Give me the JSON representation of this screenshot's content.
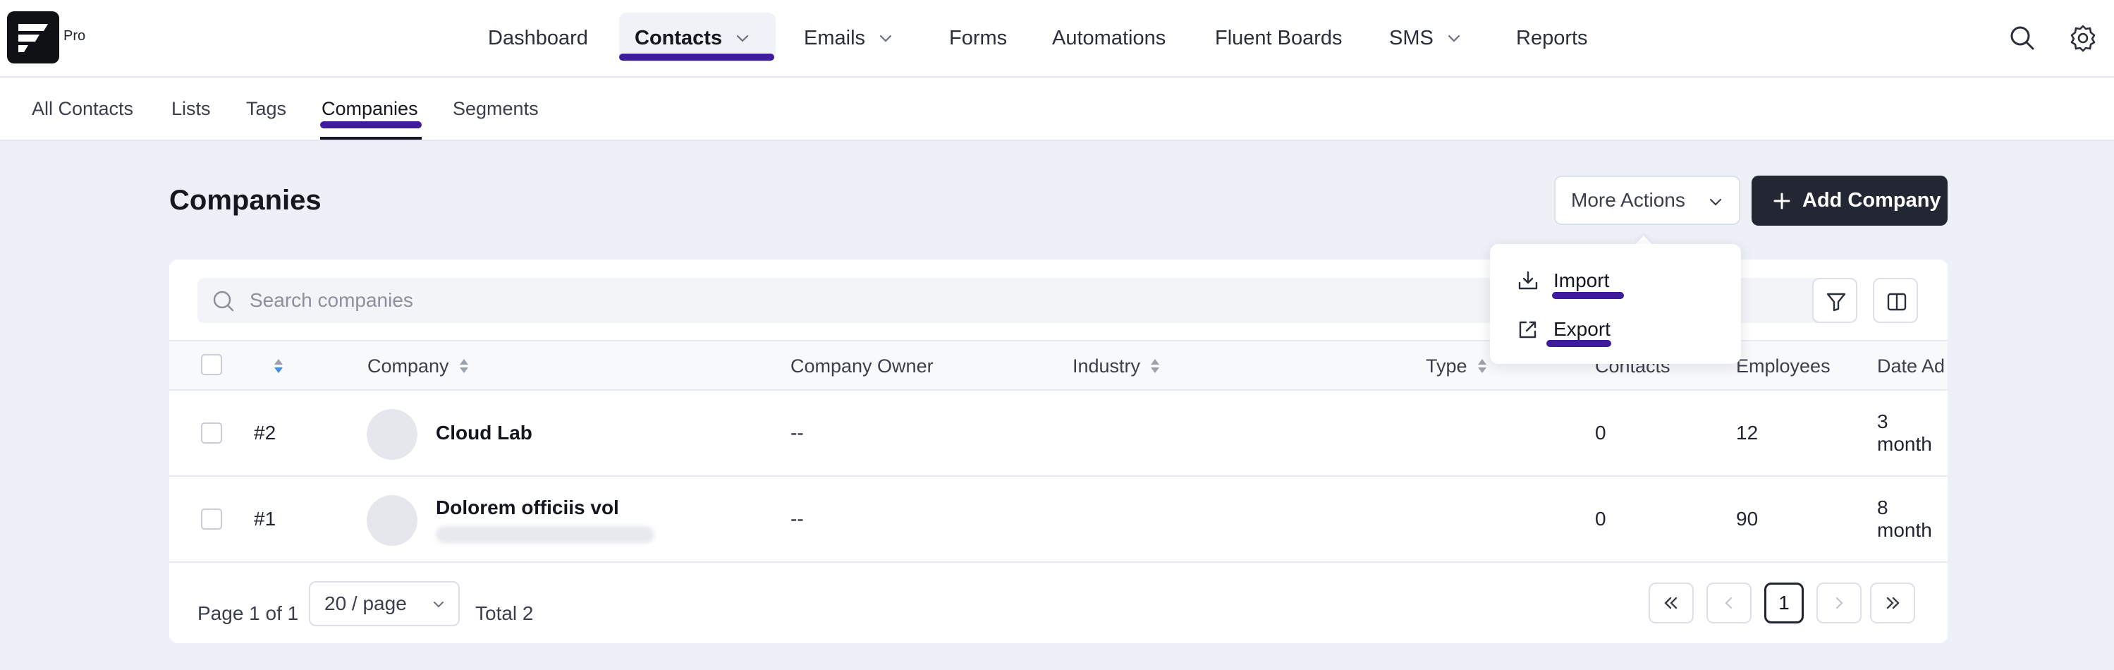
{
  "brand": {
    "badge": "Pro"
  },
  "nav": {
    "items": [
      {
        "label": "Dashboard"
      },
      {
        "label": "Contacts"
      },
      {
        "label": "Emails"
      },
      {
        "label": "Forms"
      },
      {
        "label": "Automations"
      },
      {
        "label": "Fluent Boards"
      },
      {
        "label": "SMS"
      },
      {
        "label": "Reports"
      }
    ],
    "active": "Contacts"
  },
  "subnav": {
    "items": [
      {
        "label": "All Contacts"
      },
      {
        "label": "Lists"
      },
      {
        "label": "Tags"
      },
      {
        "label": "Companies"
      },
      {
        "label": "Segments"
      }
    ],
    "active": "Companies"
  },
  "page": {
    "title": "Companies",
    "more_actions_label": "More Actions",
    "add_label": "Add Company"
  },
  "more_actions_menu": {
    "items": [
      {
        "label": "Import",
        "icon": "import-icon"
      },
      {
        "label": "Export",
        "icon": "export-icon"
      }
    ]
  },
  "search": {
    "placeholder": "Search companies",
    "value": ""
  },
  "table": {
    "columns": [
      "Company",
      "Company Owner",
      "Industry",
      "Type",
      "Contacts",
      "Employees",
      "Date Ad"
    ],
    "rows": [
      {
        "id": "#2",
        "name": "Cloud Lab",
        "owner": "--",
        "industry": "",
        "type": "",
        "contacts": "0",
        "employees": "12",
        "date": "3 month"
      },
      {
        "id": "#1",
        "name": "Dolorem officiis vol",
        "owner": "--",
        "industry": "",
        "type": "",
        "contacts": "0",
        "employees": "90",
        "date": "8 month"
      }
    ]
  },
  "pagination": {
    "page_text": "Page 1 of 1",
    "page_size": "20 / page",
    "total_text": "Total 2",
    "current_page": "1"
  },
  "colors": {
    "accent_underline": "#3d1b9c",
    "primary_button": "#232733",
    "background": "#eef0f8",
    "sort_active": "#3b8ee8"
  }
}
